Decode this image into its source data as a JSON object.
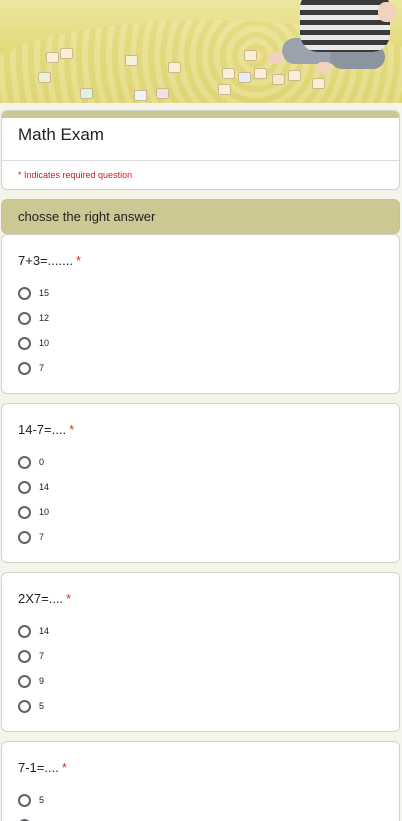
{
  "form": {
    "title": "Math Exam",
    "required_note": "* Indicates required question",
    "accent_color": "#cbc894",
    "required_color": "#d93025"
  },
  "section": {
    "title": "chosse the right answer"
  },
  "questions": [
    {
      "text": "7+3=.......",
      "required": "*",
      "options": [
        "15",
        "12",
        "10",
        "7"
      ]
    },
    {
      "text": "14-7=....",
      "required": "*",
      "options": [
        "0",
        "14",
        "10",
        "7"
      ]
    },
    {
      "text": "2X7=....",
      "required": "*",
      "options": [
        "14",
        "7",
        "9",
        "5"
      ]
    },
    {
      "text": "7-1=....",
      "required": "*",
      "options": [
        "5"
      ]
    }
  ],
  "icons": {
    "option": "radio-unchecked-icon"
  }
}
